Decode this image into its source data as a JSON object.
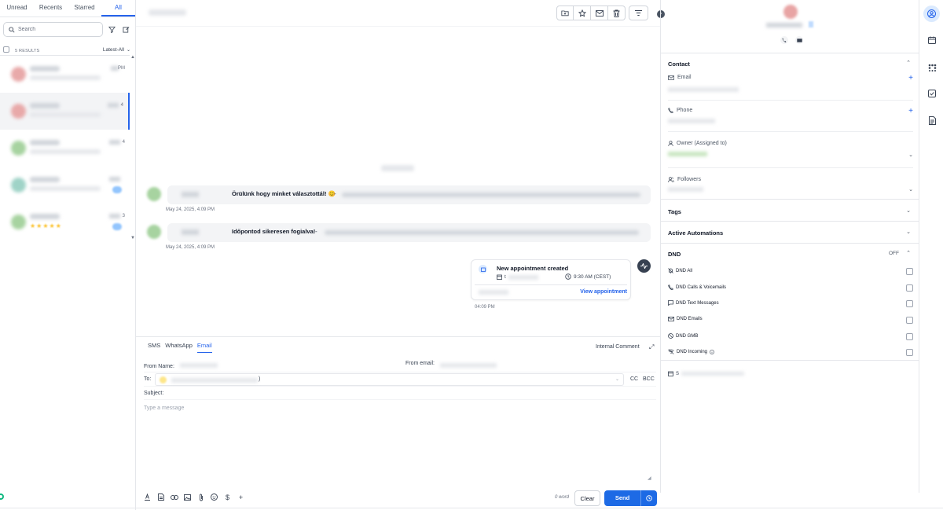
{
  "left": {
    "tabs": [
      "Unread",
      "Recents",
      "Starred",
      "All"
    ],
    "active_tab": "All",
    "search_placeholder": "Search",
    "results": "5 RESULTS",
    "sort": "Latest-All",
    "conversations": [
      {
        "time": "PM",
        "avatar_color": "#e8a9a9"
      },
      {
        "time": "4",
        "avatar_color": "#e8a9a9"
      },
      {
        "time": "4",
        "avatar_color": "#a7d3a0"
      },
      {
        "time": "",
        "avatar_color": "#9fd3c7"
      },
      {
        "time": "3",
        "avatar_color": "#a7d3a0",
        "stars": "★★★★★"
      }
    ]
  },
  "messages": [
    {
      "text": "Örülünk hogy minket választottál! 😊",
      "timestamp": "May 24, 2025, 4:09 PM"
    },
    {
      "text": "Időpontod sikeresen fogialva!",
      "timestamp": "May 24, 2025, 4:09 PM"
    }
  ],
  "appointment": {
    "title": "New appointment created",
    "date_prefix": "t",
    "time": "9:30 AM (CEST)",
    "view": "View appointment",
    "timestamp": "04:09 PM"
  },
  "composer": {
    "tabs": [
      "SMS",
      "WhatsApp",
      "Email"
    ],
    "active_tab": "Email",
    "internal_comment": "Internal Comment",
    "from_name_label": "From Name:",
    "from_email_label": "From email:",
    "to_label": "To:",
    "to_suffix": ")",
    "cc": "CC",
    "bcc": "BCC",
    "subject_label": "Subject:",
    "body_placeholder": "Type a message",
    "word_count": "0 word",
    "clear": "Clear",
    "send": "Send"
  },
  "contact_panel": {
    "contact_header": "Contact",
    "email_label": "Email",
    "phone_label": "Phone",
    "owner_label": "Owner (Assigned to)",
    "followers_label": "Followers",
    "tags_header": "Tags",
    "automations_header": "Active Automations",
    "dnd_header": "DND",
    "dnd_state": "OFF",
    "dnd_items": [
      "DND All",
      "DND Calls & Voicemails",
      "DND Text Messages",
      "DND Emails",
      "DND GMB",
      "DND Incoming"
    ],
    "footer_prefix": "S"
  },
  "colors": {
    "accent": "#2563eb",
    "send_button": "#1d6ae5"
  }
}
